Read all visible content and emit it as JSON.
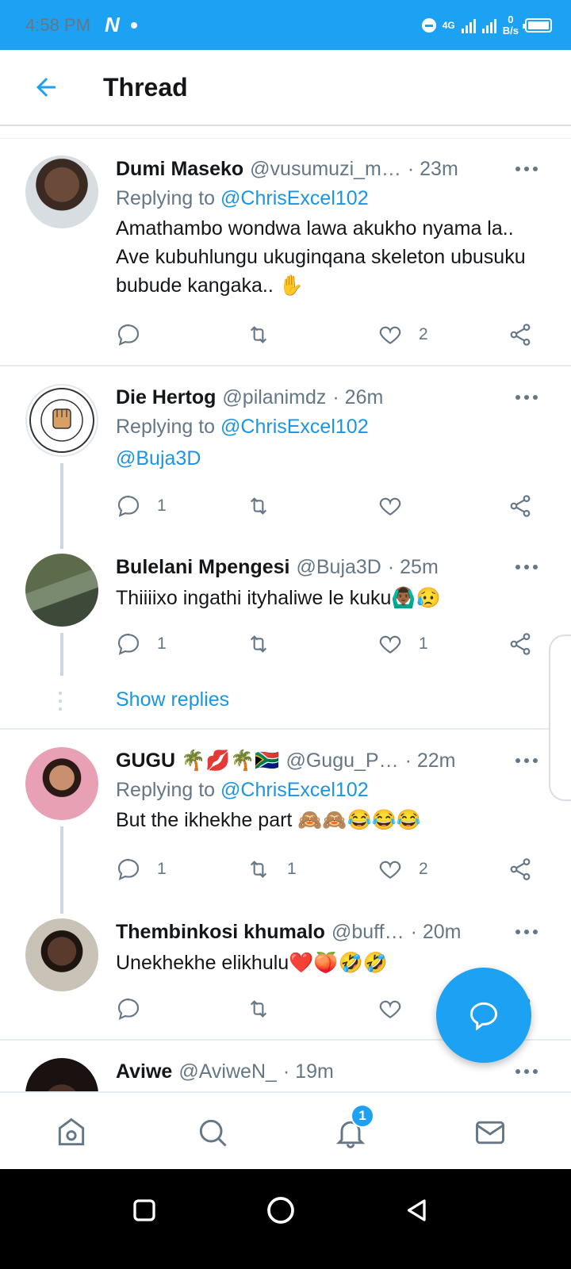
{
  "status_bar": {
    "time": "4:58 PM",
    "app_badge": "N",
    "network_type": "4G",
    "net_speed_value": "0",
    "net_speed_unit": "B/s",
    "color": "#1da1f2"
  },
  "header": {
    "title": "Thread",
    "back_icon": "arrow-left-icon"
  },
  "tweets": [
    {
      "name": "Dumi Maseko",
      "handle": "@vusumuzi_m…",
      "time": "· 23m",
      "replying_prefix": "Replying to ",
      "replying_to": "@ChrisExcel102",
      "text": "Amathambo wondwa lawa akukho nyama la.. Ave kubuhlungu ukuginqana skeleton ubusuku bubude kangaka.. ✋",
      "reply_count": "",
      "retweet_count": "",
      "like_count": "2"
    },
    {
      "name": "Die Hertog",
      "handle": "@pilanimdz",
      "time": "· 26m",
      "replying_prefix": "Replying to ",
      "replying_to": "@ChrisExcel102",
      "replying_to_2": "@Buja3D",
      "reply_count": "1",
      "retweet_count": "",
      "like_count": ""
    },
    {
      "name": "Bulelani Mpengesi",
      "handle": "@Buja3D",
      "time": "· 25m",
      "text": "Thiiiixo ingathi ityhaliwe le kuku🙆🏾‍♂️😥",
      "reply_count": "1",
      "retweet_count": "",
      "like_count": "1"
    },
    {
      "name": "GUGU 🌴💋🌴🇿🇦",
      "handle": "@Gugu_P…",
      "time": "· 22m",
      "replying_prefix": "Replying to ",
      "replying_to": "@ChrisExcel102",
      "text": "But the ikhekhe part 🙈🙈😂😂😂",
      "reply_count": "1",
      "retweet_count": "1",
      "like_count": "2"
    },
    {
      "name": "Thembinkosi khumalo",
      "handle": "@buff…",
      "time": "· 20m",
      "text": "Unekhekhe elikhulu❤️🍑🤣🤣",
      "reply_count": "",
      "retweet_count": "",
      "like_count": ""
    },
    {
      "name": "Aviwe",
      "handle": "@AviweN_",
      "time": "· 19m"
    }
  ],
  "show_replies_label": "Show replies",
  "bottom_nav": {
    "items": [
      "home-icon",
      "search-icon",
      "bell-icon",
      "mail-icon"
    ],
    "notification_badge": "1"
  },
  "accent_color": "#1da1f2"
}
